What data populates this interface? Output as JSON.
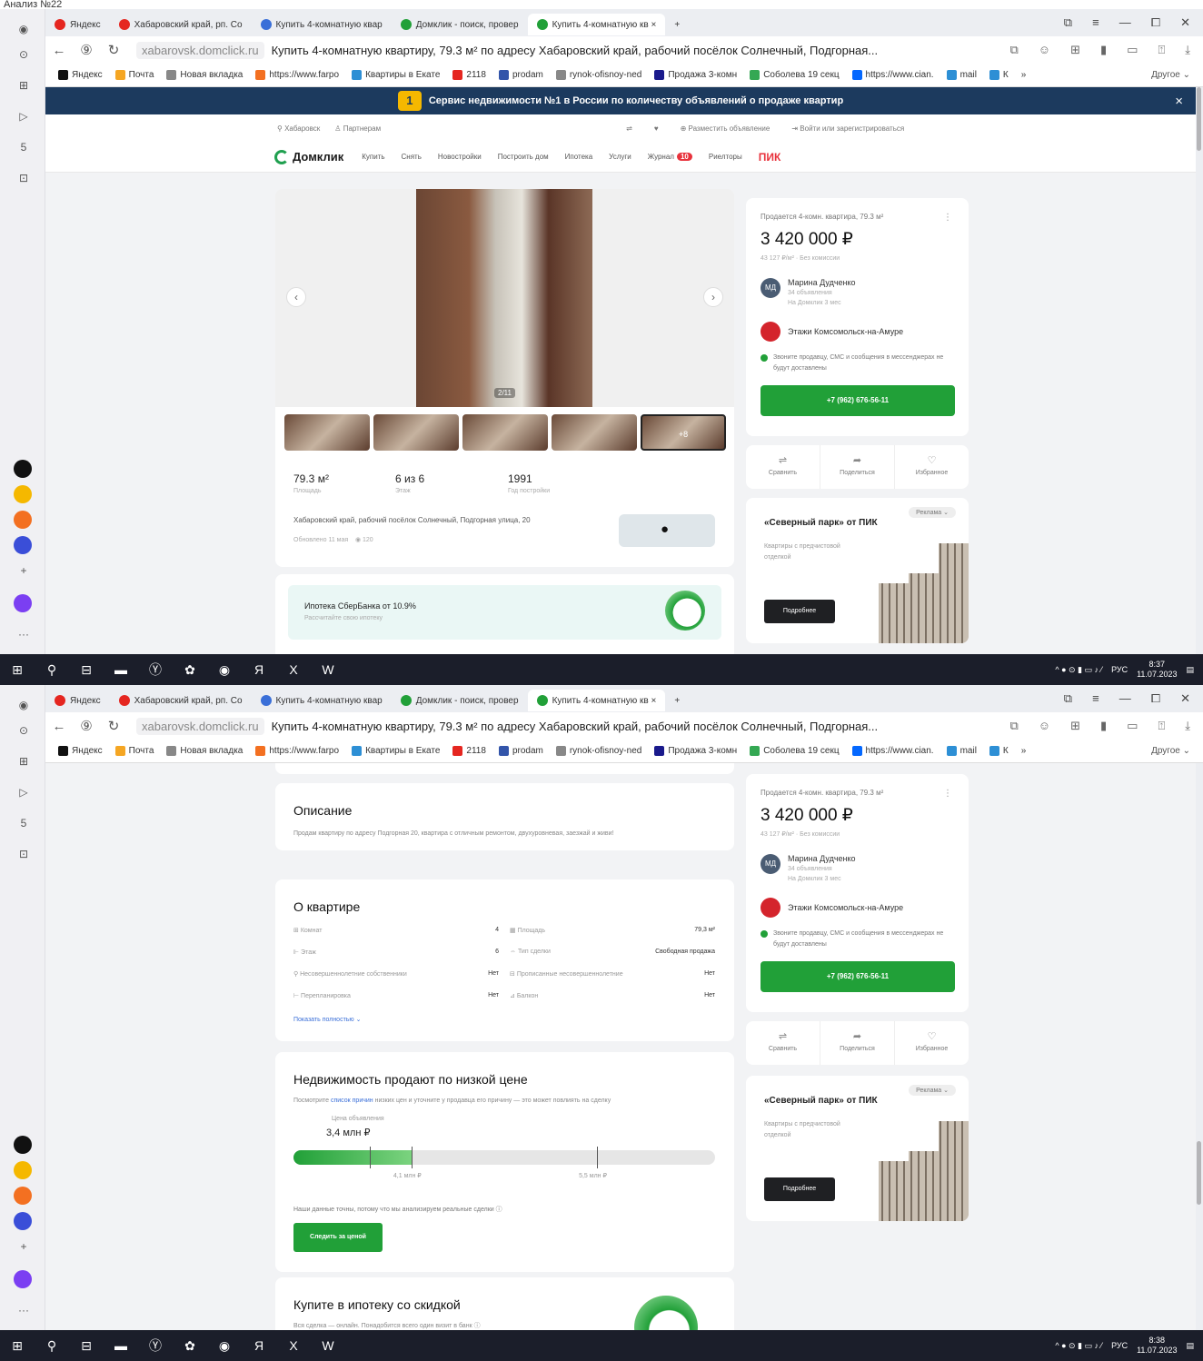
{
  "caption": "Анализ №22",
  "browser": {
    "tabs": [
      {
        "label": "Яндекс",
        "color": "#e52620"
      },
      {
        "label": "Хабаровский край, рп. Со",
        "color": "#e52620"
      },
      {
        "label": "Купить 4-комнатную квар",
        "color": "#3a6fd8"
      },
      {
        "label": "Домклик - поиск, провер",
        "color": "#21a038"
      },
      {
        "label": "Купить 4-комнатную кв ×",
        "color": "#21a038"
      }
    ],
    "new_tab": "+",
    "tab_tools": [
      "⧉",
      "≡",
      "—",
      "⧠",
      "✕"
    ],
    "nav": [
      "←",
      "⑨",
      "↻"
    ],
    "domain": "xabarovsk.domclick.ru",
    "page_title": "Купить 4-комнатную квартиру, 79.3 м² по адресу Хабаровский край, рабочий посёлок Солнечный, Подгорная...",
    "addr_tools": [
      "⧉",
      "☺",
      "⊞",
      "▮",
      "▭",
      "⍐",
      "⤓"
    ],
    "bookmarks": [
      {
        "label": "Яндекс",
        "color": "#111"
      },
      {
        "label": "Почта",
        "color": "#f5a623"
      },
      {
        "label": "Новая вкладка",
        "color": "#888"
      },
      {
        "label": "https://www.farpo",
        "color": "#f37021"
      },
      {
        "label": "Квартиры в Екате",
        "color": "#2d8fd5"
      },
      {
        "label": "2118",
        "color": "#e52620"
      },
      {
        "label": "prodam",
        "color": "#3355aa"
      },
      {
        "label": "rynok-ofisnoy-ned",
        "color": "#888"
      },
      {
        "label": "Продажа 3-комн",
        "color": "#1a1a8c"
      },
      {
        "label": "Соболева 19 секц",
        "color": "#34a853"
      },
      {
        "label": "https://www.cian.",
        "color": "#0468ff"
      },
      {
        "label": "mail",
        "color": "#2d8fd5"
      },
      {
        "label": "К",
        "color": "#2d8fd5"
      },
      {
        "label": "»",
        "color": "#fff"
      }
    ],
    "other": "Другое ⌄"
  },
  "sidebar": {
    "icons": [
      "⊙",
      "⊞",
      "▷",
      "5",
      "⊡"
    ],
    "apps": [
      {
        "name": "plus-circle-icon",
        "color": "#111"
      },
      {
        "name": "market-icon",
        "color": "#f5b800"
      },
      {
        "name": "mail-icon",
        "color": "#f37021"
      },
      {
        "name": "messenger-icon",
        "color": "#3a4ed8"
      },
      {
        "name": "alice-icon",
        "color": "#7b3ff2"
      }
    ],
    "add": "+",
    "more": "···"
  },
  "banner": {
    "badge": "1",
    "text": "Сервис недвижимости №1 в России по количеству объявлений о продаже квартир",
    "close": "×"
  },
  "topnav": {
    "city": "Хабаровск",
    "partners": "Партнерам",
    "post_ad": "Разместить объявление",
    "login": "Войти или зарегистрироваться"
  },
  "menu": {
    "logo": "Домклик",
    "items": [
      "Купить",
      "Снять",
      "Новостройки",
      "Построить дом",
      "Ипотека",
      "Услуги",
      "Журнал"
    ],
    "journal_badge": "10",
    "realtors": "Риелторы",
    "pik": "ПИК"
  },
  "listing": {
    "photo_counter": "2/11",
    "more_photos": "+8",
    "area": {
      "value": "79.3 м²",
      "label": "Площадь"
    },
    "floor": {
      "value": "6 из 6",
      "label": "Этаж"
    },
    "year": {
      "value": "1991",
      "label": "Год постройки"
    },
    "address": "Хабаровский край, рабочий посёлок Солнечный, Подгорная улица, 20",
    "updated": "Обновлено 11 мая",
    "views": "◉ 120",
    "mortgage_title": "Ипотека СберБанка от 10.9%",
    "mortgage_sub": "Рассчитайте свою ипотеку"
  },
  "price_card": {
    "heading": "Продается 4-комн. квартира, 79.3 м²",
    "price": "3 420 000 ₽",
    "per_m2": "43 127 ₽/м² · Без комиссии",
    "more": "⋮",
    "agent_initials": "МД",
    "agent_name": "Марина Дудченко",
    "agent_ads": "34 объявления",
    "agent_since": "На Домклик 3 мес",
    "agency": "Этажи Комсомольск-на-Амуре",
    "note": "Звоните продавцу, СМС и сообщения в мессенджерах не будут доставлены",
    "phone": "+7 (962) 676-56-11"
  },
  "actions": [
    {
      "icon": "⇌",
      "label": "Сравнить"
    },
    {
      "icon": "➦",
      "label": "Поделиться"
    },
    {
      "icon": "♡",
      "label": "Избранное"
    }
  ],
  "ad": {
    "title": "«Северный парк» от ПИК",
    "text": "Квартиры с предчистовой отделкой",
    "tag": "Реклама ⌄",
    "button": "Подробнее"
  },
  "taskbar1": {
    "time": "8:37",
    "date": "11.07.2023",
    "lang": "РУС"
  },
  "taskbar2": {
    "time": "8:38",
    "date": "11.07.2023",
    "lang": "РУС"
  },
  "taskbar_icons": [
    "⊞",
    "⚲",
    "⊟",
    "▬",
    "Ⓨ",
    "✿",
    "◉",
    "Я",
    "X",
    "W"
  ],
  "tray_icons": "^ ● ⊙ ▮ ▭ ♪ ⁄",
  "description": {
    "title": "Описание",
    "text": "Продам квартиру по адресу Подгорная 20, квартира с отличным ремонтом, двухуровневая, заезжай и живи!"
  },
  "about": {
    "title": "О квартире",
    "left": [
      {
        "label": "Комнат",
        "value": "4"
      },
      {
        "label": "Этаж",
        "value": "6"
      },
      {
        "label": "Несовершеннолетние собственники",
        "value": "Нет"
      },
      {
        "label": "Перепланировка",
        "value": "Нет"
      }
    ],
    "right": [
      {
        "label": "Площадь",
        "value": "79,3 м²"
      },
      {
        "label": "Тип сделки",
        "value": "Свободная продажа"
      },
      {
        "label": "Прописанные несовершеннолетние",
        "value": "Нет"
      },
      {
        "label": "Балкон",
        "value": "Нет"
      }
    ],
    "show_all": "Показать полностью ⌄"
  },
  "low_price": {
    "title": "Недвижимость продают по низкой цене",
    "sub_pre": "Посмотрите ",
    "sub_link": "список причин",
    "sub_post": " низких цен и уточните у продавца его причину — это может повлиять на сделку",
    "price_label": "Цена объявления",
    "price_value": "3,4 млн ₽",
    "price_fraction": 0.18,
    "green_fraction": 0.28,
    "mark1_fraction": 0.28,
    "mark2_fraction": 0.72,
    "mark1_label": "4,1 млн ₽",
    "mark2_label": "5,5 млн ₽",
    "accuracy": "Наши данные точны, потому что мы анализируем реальные сделки ⓘ",
    "button": "Следить за ценой"
  },
  "discount": {
    "title": "Купите в ипотеку со скидкой",
    "text": "Вся сделка — онлайн. Понадобится всего один визит в банк ⓘ"
  },
  "scroll": {
    "shot1_fraction": 0.0,
    "shot2_fraction": 0.75
  }
}
